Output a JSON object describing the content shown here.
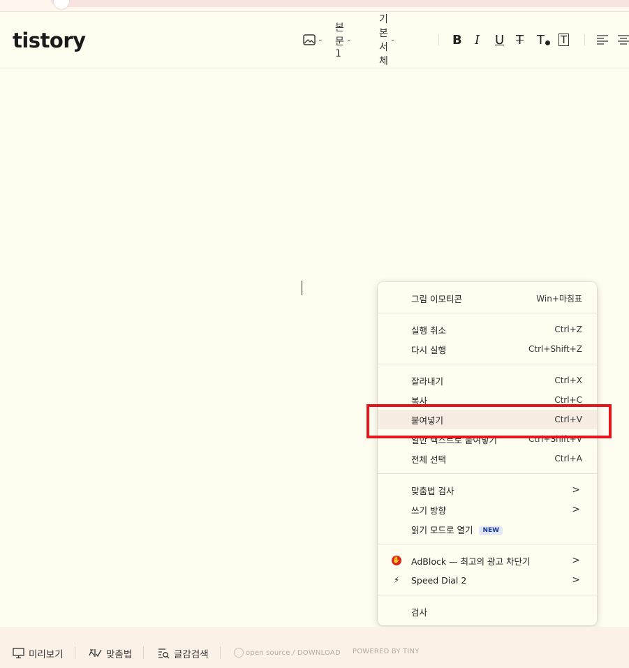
{
  "logo": "tistory",
  "toolbar": {
    "image_btn": "image",
    "paragraph_style": "본문1",
    "font_family": "기본서체",
    "bold": "B",
    "italic": "I",
    "underline": "U",
    "strikethrough": "T",
    "text_color": "T",
    "bg_color": "T"
  },
  "context_menu": {
    "sections": [
      [
        {
          "label": "그림 이모티콘",
          "shortcut": "Win+마침표"
        }
      ],
      [
        {
          "label": "실행 취소",
          "shortcut": "Ctrl+Z"
        },
        {
          "label": "다시 실행",
          "shortcut": "Ctrl+Shift+Z"
        }
      ],
      [
        {
          "label": "잘라내기",
          "shortcut": "Ctrl+X"
        },
        {
          "label": "복사",
          "shortcut": "Ctrl+C"
        },
        {
          "label": "붙여넣기",
          "shortcut": "Ctrl+V"
        },
        {
          "label": "일반 텍스트로 붙여넣기",
          "shortcut": "Ctrl+Shift+V"
        },
        {
          "label": "전체 선택",
          "shortcut": "Ctrl+A"
        }
      ],
      [
        {
          "label": "맞춤법 검사",
          "arrow": ">"
        },
        {
          "label": "쓰기 방향",
          "arrow": ">"
        },
        {
          "label": "읽기 모드로 열기",
          "badge": "NEW"
        }
      ],
      [
        {
          "label": "AdBlock — 최고의 광고 차단기",
          "arrow": ">"
        },
        {
          "label": "Speed Dial 2",
          "arrow": ">"
        }
      ],
      [
        {
          "label": "검사"
        }
      ]
    ]
  },
  "footer": {
    "preview": "미리보기",
    "spellcheck": "맞춤법",
    "search": "글감검색",
    "open_source": "open source / DOWNLOAD",
    "powered": "POWERED BY TINY"
  }
}
